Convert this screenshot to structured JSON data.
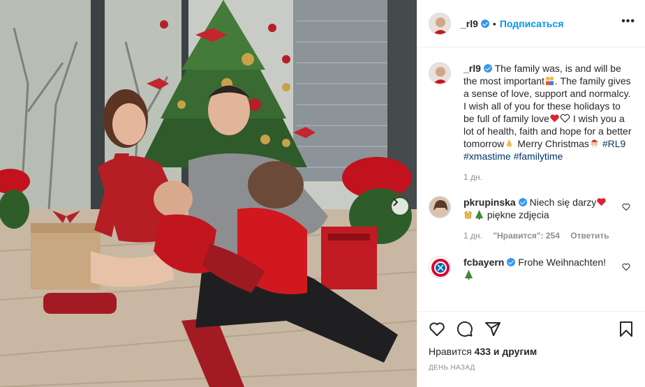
{
  "post": {
    "username": "_rl9",
    "follow_label": "Подписаться",
    "more_label": "•••",
    "icons": [
      "chevron-right-icon",
      "heart-icon",
      "comment-icon",
      "share-icon",
      "bookmark-icon",
      "verified-icon"
    ]
  },
  "caption": {
    "username": "_rl9",
    "text_1": "The family was, is and will be the most important",
    "text_2": ". The family gives a sense of love, support and normalcy. I wish all of you for these holidays to be full of family love",
    "text_3": "I wish you a lot of health, faith and hope for a better tomorrow",
    "text_4": "Merry Christmas",
    "tags": [
      "#RL9",
      "#xmastime",
      "#familytime"
    ],
    "time": "1 дн."
  },
  "comments": [
    {
      "username": "pkrupinska",
      "text_1": "Niech się darzy",
      "text_2": "piękne zdjęcia",
      "time": "1 дн.",
      "likes": "\"Нравится\": 254",
      "reply": "Ответить"
    },
    {
      "username": "fcbayern",
      "text_1": "Frohe Weihnachten!"
    }
  ],
  "actions": {
    "likes_prefix": "Нравится",
    "likes_count": "433",
    "likes_suffix": "и другим",
    "date": "ДЕНЬ НАЗАД"
  },
  "colors": {
    "accent": "#0095f6",
    "verified": "#3897f0",
    "heart": "#ed4956",
    "hashtag": "#00376b",
    "muted": "#8e8e8e"
  }
}
